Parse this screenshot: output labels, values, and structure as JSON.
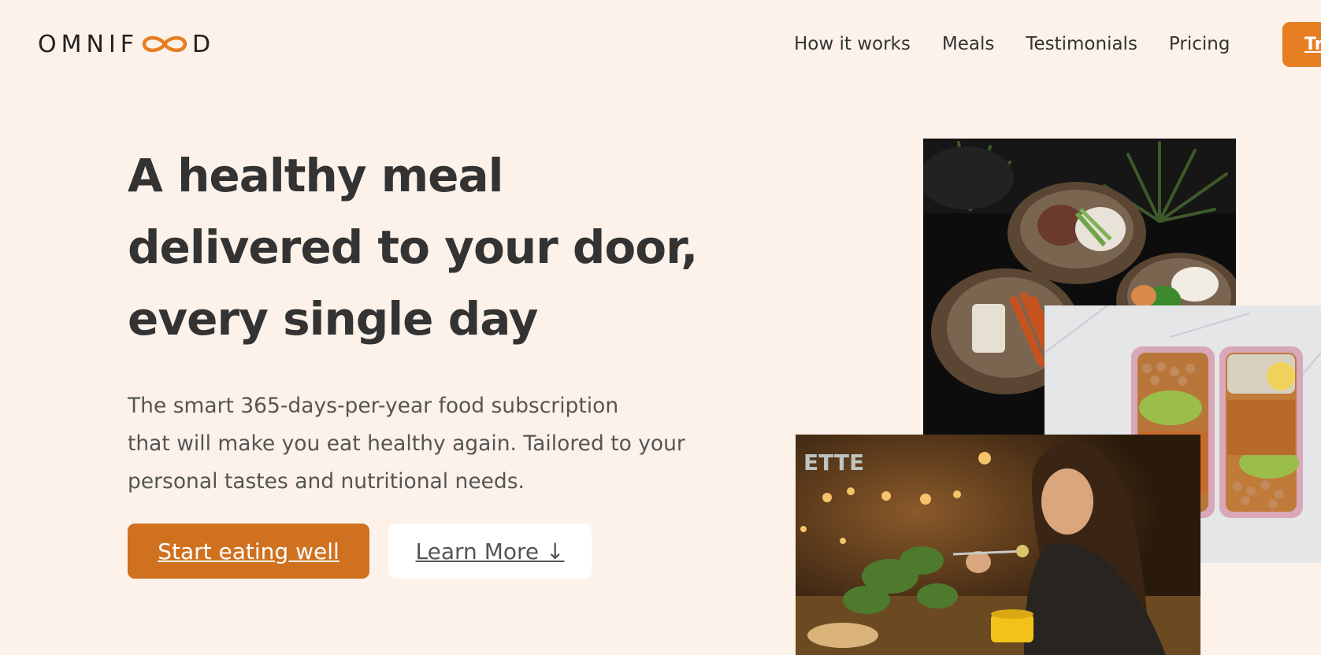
{
  "header": {
    "logo_text_before": "OMNIF",
    "logo_text_after": "D",
    "nav": [
      {
        "label": "How it works"
      },
      {
        "label": "Meals"
      },
      {
        "label": "Testimonials"
      },
      {
        "label": "Pricing"
      }
    ],
    "cta_label": "Try for free"
  },
  "hero": {
    "title_lines": [
      "A healthy meal",
      "delivered to your door,",
      "every single day"
    ],
    "description_lines": [
      "The smart 365-days-per-year food subscription",
      "that will make you eat healthy again. Tailored to your",
      "personal tastes and nutritional needs."
    ],
    "primary_button": "Start eating well",
    "secondary_button": "Learn More ↓"
  },
  "colors": {
    "background": "#fdf2e9",
    "accent": "#e67e22",
    "primary_button": "#cf711f",
    "text": "#333333"
  },
  "images": {
    "bowls": "meal-bowls-image",
    "prep": "meal-prep-containers-image",
    "woman": "woman-eating-image"
  }
}
